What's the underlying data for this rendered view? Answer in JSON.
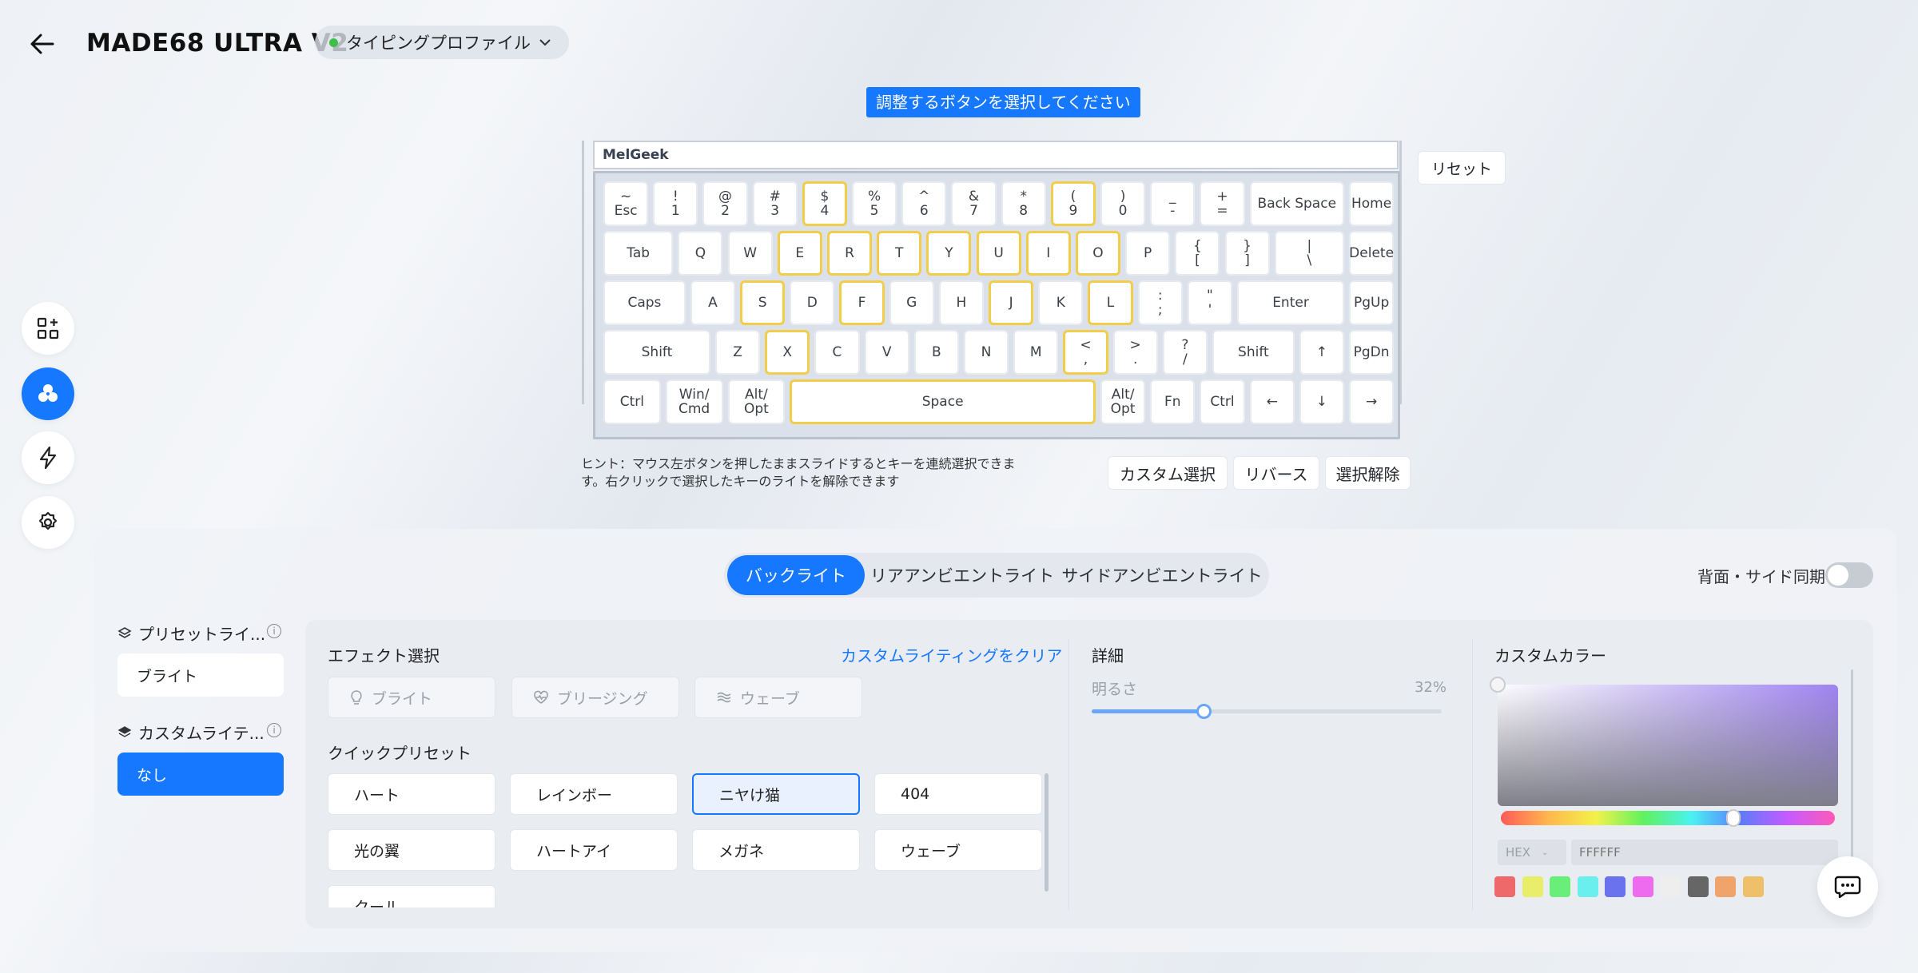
{
  "header": {
    "device_name": "MADE68 ULTRA V2",
    "profile": "タイピングプロファイル",
    "profile_status_color": "#3fbf4a"
  },
  "nav": [
    "grid-add-icon",
    "palette-icon",
    "lightning-icon",
    "gear-icon"
  ],
  "keyboard": {
    "tip": "調整するボタンを選択してください",
    "brand": "MelGeek",
    "reset_label": "リセット",
    "hint_line1": "ヒント：マウス左ボタンを押したままスライドするとキーを連続選択できま",
    "hint_line2": "す。右クリックで選択したキーのライトを解除できます",
    "custom_select": "カスタム選択",
    "reverse": "リバース",
    "deselect": "選択解除",
    "rows": [
      [
        {
          "l": [
            "~",
            "Esc"
          ]
        },
        {
          "l": [
            "!",
            "1"
          ]
        },
        {
          "l": [
            "@",
            "2"
          ]
        },
        {
          "l": [
            "#",
            "3"
          ]
        },
        {
          "l": [
            "$",
            "4"
          ],
          "s": true
        },
        {
          "l": [
            "%",
            "5"
          ]
        },
        {
          "l": [
            "^",
            "6"
          ]
        },
        {
          "l": [
            "&",
            "7"
          ]
        },
        {
          "l": [
            "*",
            "8"
          ]
        },
        {
          "l": [
            "(",
            "9"
          ],
          "s": true
        },
        {
          "l": [
            ")",
            "0"
          ]
        },
        {
          "l": [
            "_",
            "-"
          ]
        },
        {
          "l": [
            "+",
            "="
          ]
        },
        {
          "l": [
            "Back Space"
          ],
          "w": 2
        },
        {
          "l": [
            "Home"
          ]
        }
      ],
      [
        {
          "l": [
            "Tab"
          ],
          "w": 1.5
        },
        {
          "l": [
            "Q"
          ]
        },
        {
          "l": [
            "W"
          ]
        },
        {
          "l": [
            "E"
          ],
          "s": true
        },
        {
          "l": [
            "R"
          ],
          "s": true
        },
        {
          "l": [
            "T"
          ],
          "s": true
        },
        {
          "l": [
            "Y"
          ],
          "s": true
        },
        {
          "l": [
            "U"
          ],
          "s": true
        },
        {
          "l": [
            "I"
          ],
          "s": true
        },
        {
          "l": [
            "O"
          ],
          "s": true
        },
        {
          "l": [
            "P"
          ]
        },
        {
          "l": [
            "{",
            "["
          ]
        },
        {
          "l": [
            "}",
            "]"
          ]
        },
        {
          "l": [
            "|",
            "\\"
          ],
          "w": 1.5
        },
        {
          "l": [
            "Delete"
          ]
        }
      ],
      [
        {
          "l": [
            "Caps"
          ],
          "w": 1.75
        },
        {
          "l": [
            "A"
          ]
        },
        {
          "l": [
            "S"
          ],
          "s": true
        },
        {
          "l": [
            "D"
          ]
        },
        {
          "l": [
            "F"
          ],
          "s": true
        },
        {
          "l": [
            "G"
          ]
        },
        {
          "l": [
            "H"
          ]
        },
        {
          "l": [
            "J"
          ],
          "s": true
        },
        {
          "l": [
            "K"
          ]
        },
        {
          "l": [
            "L"
          ],
          "s": true
        },
        {
          "l": [
            ":",
            ";"
          ]
        },
        {
          "l": [
            "\"",
            "'"
          ]
        },
        {
          "l": [
            "Enter"
          ],
          "w": 2.25
        },
        {
          "l": [
            "PgUp"
          ]
        }
      ],
      [
        {
          "l": [
            "Shift"
          ],
          "w": 2.25
        },
        {
          "l": [
            "Z"
          ]
        },
        {
          "l": [
            "X"
          ],
          "s": true
        },
        {
          "l": [
            "C"
          ]
        },
        {
          "l": [
            "V"
          ]
        },
        {
          "l": [
            "B"
          ]
        },
        {
          "l": [
            "N"
          ]
        },
        {
          "l": [
            "M"
          ]
        },
        {
          "l": [
            "<",
            ","
          ],
          "s": true
        },
        {
          "l": [
            ">",
            "."
          ]
        },
        {
          "l": [
            "?",
            "/"
          ]
        },
        {
          "l": [
            "Shift"
          ],
          "w": 1.75
        },
        {
          "l": [
            "↑"
          ]
        },
        {
          "l": [
            "PgDn"
          ]
        }
      ],
      [
        {
          "l": [
            "Ctrl"
          ],
          "w": 1.25
        },
        {
          "l": [
            "Win/",
            "Cmd"
          ],
          "w": 1.25
        },
        {
          "l": [
            "Alt/",
            "Opt"
          ],
          "w": 1.25
        },
        {
          "l": [
            "Space"
          ],
          "w": 6.25,
          "s": true
        },
        {
          "l": [
            "Alt/",
            "Opt"
          ]
        },
        {
          "l": [
            "Fn"
          ]
        },
        {
          "l": [
            "Ctrl"
          ]
        },
        {
          "l": [
            "←"
          ]
        },
        {
          "l": [
            "↓"
          ]
        },
        {
          "l": [
            "→"
          ]
        }
      ]
    ]
  },
  "tabs": {
    "backlight": "バックライト",
    "rear": "リアアンビエントライト",
    "side": "サイドアンビエントライト",
    "sync_label": "背面・サイド同期"
  },
  "left_panel": {
    "preset_title": "プリセットライ...",
    "preset_value": "ブライト",
    "custom_title": "カスタムライテ...",
    "custom_value": "なし"
  },
  "effects": {
    "title": "エフェクト選択",
    "clear_link": "カスタムライティングをクリア",
    "items": [
      "ブライト",
      "ブリージング",
      "ウェーブ"
    ]
  },
  "quick_presets": {
    "title": "クイックプリセット",
    "items": [
      "ハート",
      "レインボー",
      "ニヤけ猫",
      "404",
      "光の翼",
      "ハートアイ",
      "メガネ",
      "ウェーブ",
      "クール"
    ],
    "selected": "ニヤけ猫"
  },
  "detail": {
    "title": "詳細",
    "brightness_label": "明るさ",
    "brightness_value": "32%",
    "brightness_pct": 32
  },
  "custom_color": {
    "title": "カスタムカラー",
    "format": "HEX",
    "hex_placeholder": "FFFFFF",
    "swatches": [
      "#ee6a6a",
      "#e8ee6a",
      "#6aee7a",
      "#6aeeee",
      "#6a72ee",
      "#ee6aee",
      "#eeeeee",
      "#666666",
      "#eea46a",
      "#eec06a"
    ]
  },
  "colors": {
    "accent": "#1677ff",
    "selected_key_border": "#f2cd4a"
  }
}
